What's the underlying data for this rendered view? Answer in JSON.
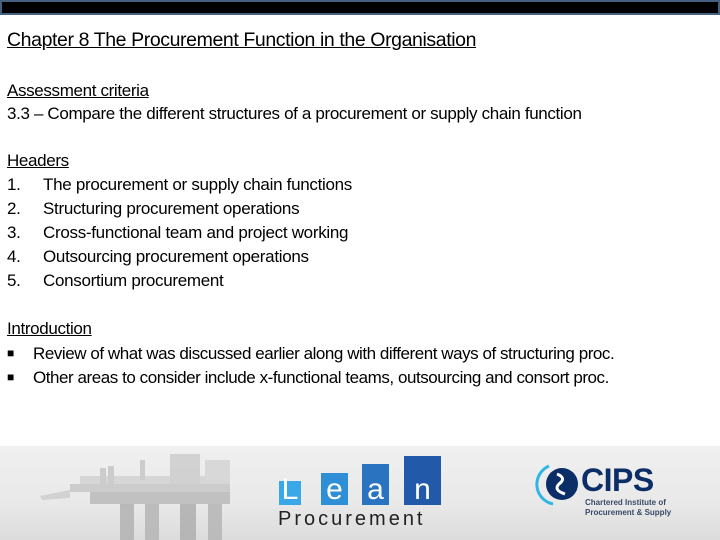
{
  "slide": {
    "title": "Chapter 8  The Procurement Function in the Organisation",
    "assessment": {
      "heading": "Assessment criteria",
      "text": "3.3 – Compare the different structures of a procurement or supply chain function"
    },
    "headers": {
      "heading": "Headers",
      "items": [
        {
          "num": "1.",
          "label": "The procurement or supply chain functions"
        },
        {
          "num": "2.",
          "label": "Structuring procurement operations"
        },
        {
          "num": "3.",
          "label": "Cross-functional team and project working"
        },
        {
          "num": "4.",
          "label": "Outsourcing procurement operations"
        },
        {
          "num": "5.",
          "label": "Consortium procurement"
        }
      ]
    },
    "introduction": {
      "heading": "Introduction",
      "bullet_glyph": "■",
      "items": [
        "Review of what was discussed earlier along with different ways of structuring proc.",
        "Other areas to consider include x-functional teams, outsourcing and consort proc."
      ]
    }
  },
  "banner": {
    "lean_logo": {
      "letters": [
        "L",
        "e",
        "a",
        "n"
      ],
      "word": "Procurement",
      "colors": [
        "#3aa8e8",
        "#2f8fd6",
        "#2a73c0",
        "#2259a8"
      ]
    },
    "cips_logo": {
      "name": "CIPS",
      "line1": "Chartered Institute of",
      "line2": "Procurement & Supply",
      "color": "#0c2e66",
      "accent": "#2fb6e6"
    }
  }
}
